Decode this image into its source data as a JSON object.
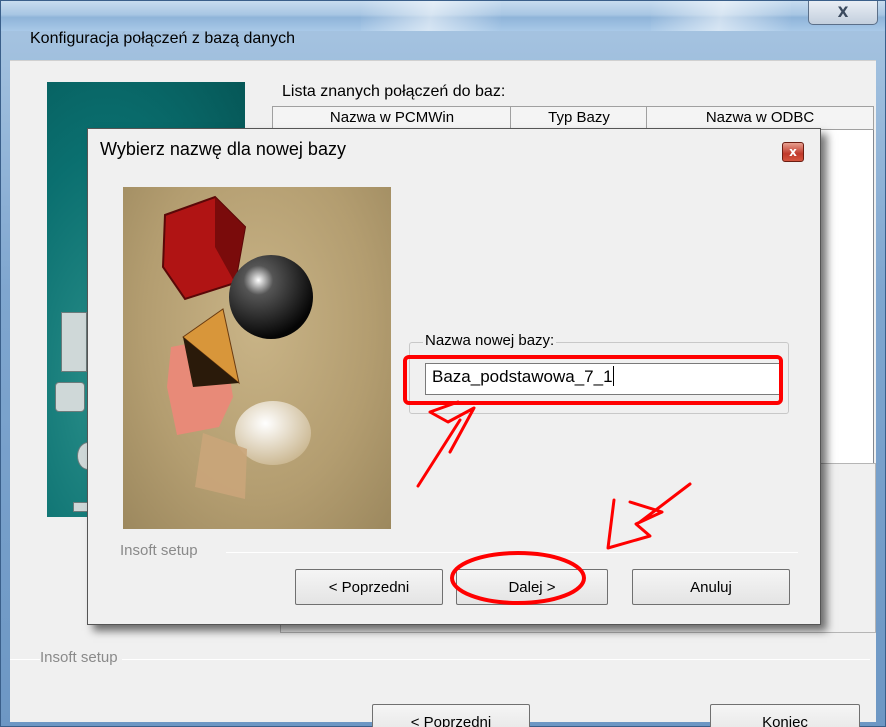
{
  "outer_window": {
    "title": "Konfiguracja połączeń z bazą danych",
    "close_glyph": "X",
    "list_label": "Lista znanych połączeń do baz:",
    "columns": [
      "Nazwa w PCMWin",
      "Typ Bazy",
      "Nazwa w ODBC"
    ],
    "group_label": "Insoft setup",
    "buttons": {
      "prev": "< Poprzedni",
      "finish": "Koniec"
    }
  },
  "dialog": {
    "title": "Wybierz nazwę dla nowej bazy",
    "close_glyph": "x",
    "name_group_label": "Nazwa nowej bazy:",
    "name_value": "Baza_podstawowa_7_1",
    "group_label": "Insoft setup",
    "buttons": {
      "prev": "< Poprzedni",
      "next": "Dalej >",
      "cancel": "Anuluj"
    }
  },
  "colors": {
    "annotation": "#ff0000",
    "teal_panel": "#0a6f6f",
    "titlebar": "#a8c6e3"
  },
  "icons": [
    "close-icon",
    "computer-illustration",
    "3d-shapes-illustration"
  ]
}
